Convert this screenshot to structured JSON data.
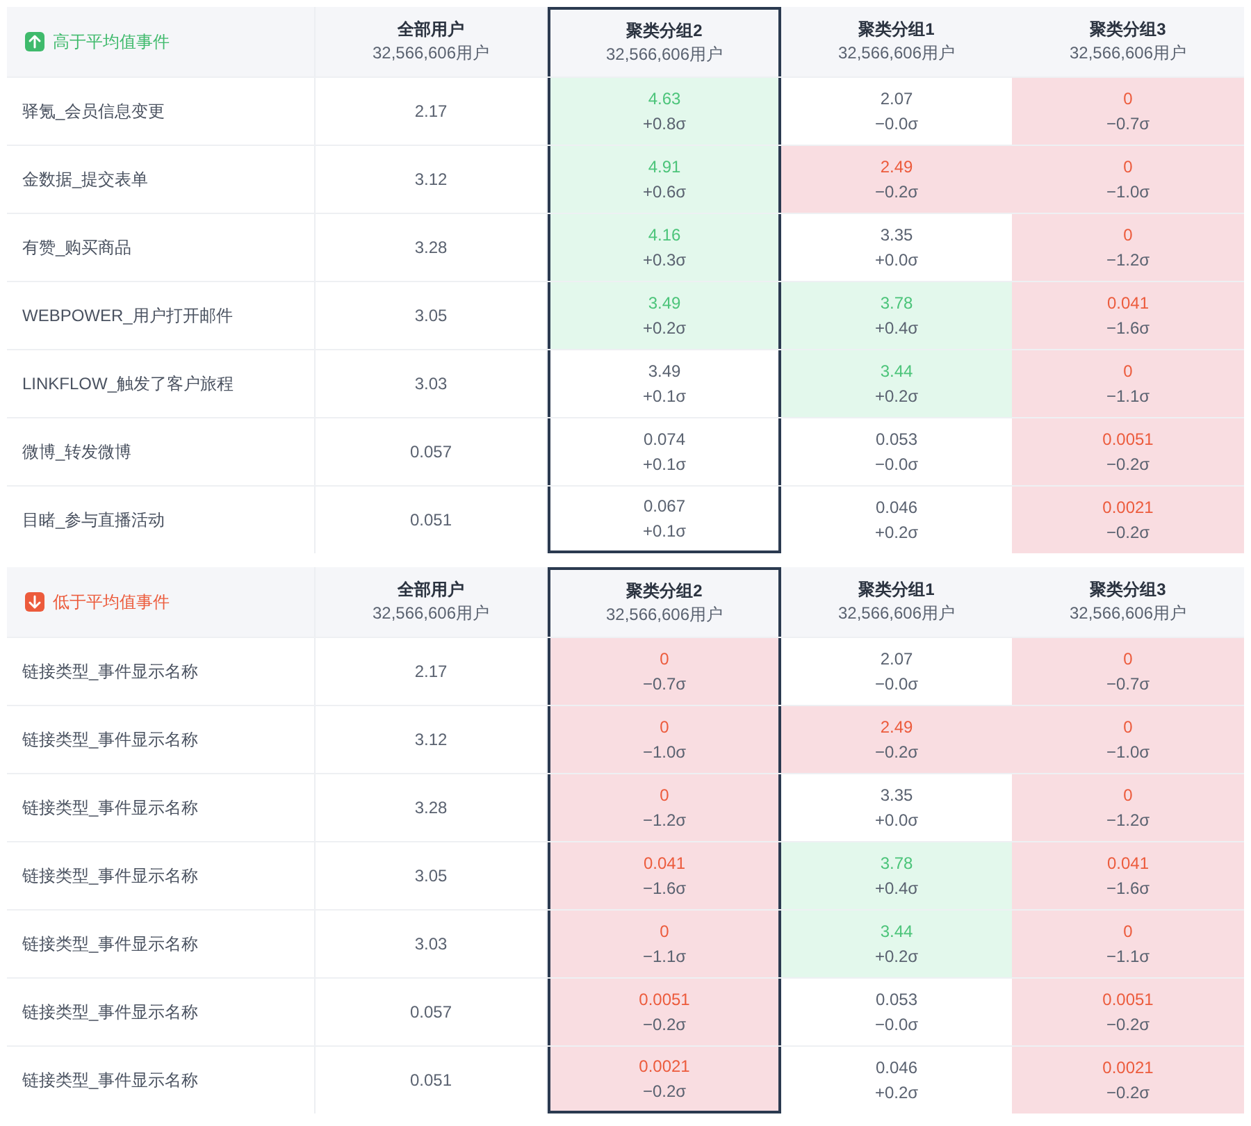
{
  "sections": [
    {
      "kind": "above",
      "title": "高于平均值事件",
      "columns": [
        {
          "title": "全部用户",
          "count": "32,566,606用户",
          "selected": false
        },
        {
          "title": "聚类分组2",
          "count": "32,566,606用户",
          "selected": true
        },
        {
          "title": "聚类分组1",
          "count": "32,566,606用户",
          "selected": false
        },
        {
          "title": "聚类分组3",
          "count": "32,566,606用户",
          "selected": false
        }
      ],
      "rows": [
        {
          "event": "驿氪_会员信息变更",
          "cells": [
            {
              "value": "2.17",
              "high": false,
              "low": false
            },
            {
              "value": "4.63",
              "sigma": "+0.8σ",
              "high": true,
              "low": false
            },
            {
              "value": "2.07",
              "sigma": "−0.0σ",
              "high": false,
              "low": false
            },
            {
              "value": "0",
              "sigma": "−0.7σ",
              "high": false,
              "low": true
            }
          ]
        },
        {
          "event": "金数据_提交表单",
          "cells": [
            {
              "value": "3.12",
              "high": false,
              "low": false
            },
            {
              "value": "4.91",
              "sigma": "+0.6σ",
              "high": true,
              "low": false
            },
            {
              "value": "2.49",
              "sigma": "−0.2σ",
              "high": false,
              "low": true
            },
            {
              "value": "0",
              "sigma": "−1.0σ",
              "high": false,
              "low": true
            }
          ]
        },
        {
          "event": "有赞_购买商品",
          "cells": [
            {
              "value": "3.28",
              "high": false,
              "low": false
            },
            {
              "value": "4.16",
              "sigma": "+0.3σ",
              "high": true,
              "low": false
            },
            {
              "value": "3.35",
              "sigma": "+0.0σ",
              "high": false,
              "low": false
            },
            {
              "value": "0",
              "sigma": "−1.2σ",
              "high": false,
              "low": true
            }
          ]
        },
        {
          "event": "WEBPOWER_用户打开邮件",
          "cells": [
            {
              "value": "3.05",
              "high": false,
              "low": false
            },
            {
              "value": "3.49",
              "sigma": "+0.2σ",
              "high": true,
              "low": false
            },
            {
              "value": "3.78",
              "sigma": "+0.4σ",
              "high": true,
              "low": false
            },
            {
              "value": "0.041",
              "sigma": "−1.6σ",
              "high": false,
              "low": true
            }
          ]
        },
        {
          "event": "LINKFLOW_触发了客户旅程",
          "cells": [
            {
              "value": "3.03",
              "high": false,
              "low": false
            },
            {
              "value": "3.49",
              "sigma": "+0.1σ",
              "high": false,
              "low": false
            },
            {
              "value": "3.44",
              "sigma": "+0.2σ",
              "high": true,
              "low": false
            },
            {
              "value": "0",
              "sigma": "−1.1σ",
              "high": false,
              "low": true
            }
          ]
        },
        {
          "event": "微博_转发微博",
          "cells": [
            {
              "value": "0.057",
              "high": false,
              "low": false
            },
            {
              "value": "0.074",
              "sigma": "+0.1σ",
              "high": false,
              "low": false
            },
            {
              "value": "0.053",
              "sigma": "−0.0σ",
              "high": false,
              "low": false
            },
            {
              "value": "0.0051",
              "sigma": "−0.2σ",
              "high": false,
              "low": true
            }
          ]
        },
        {
          "event": "目睹_参与直播活动",
          "cells": [
            {
              "value": "0.051",
              "high": false,
              "low": false
            },
            {
              "value": "0.067",
              "sigma": "+0.1σ",
              "high": false,
              "low": false
            },
            {
              "value": "0.046",
              "sigma": "+0.2σ",
              "high": false,
              "low": false
            },
            {
              "value": "0.0021",
              "sigma": "−0.2σ",
              "high": false,
              "low": true
            }
          ]
        }
      ]
    },
    {
      "kind": "below",
      "title": "低于平均值事件",
      "columns": [
        {
          "title": "全部用户",
          "count": "32,566,606用户",
          "selected": false
        },
        {
          "title": "聚类分组2",
          "count": "32,566,606用户",
          "selected": true
        },
        {
          "title": "聚类分组1",
          "count": "32,566,606用户",
          "selected": false
        },
        {
          "title": "聚类分组3",
          "count": "32,566,606用户",
          "selected": false
        }
      ],
      "rows": [
        {
          "event": "链接类型_事件显示名称",
          "cells": [
            {
              "value": "2.17",
              "high": false,
              "low": false
            },
            {
              "value": "0",
              "sigma": "−0.7σ",
              "high": false,
              "low": true
            },
            {
              "value": "2.07",
              "sigma": "−0.0σ",
              "high": false,
              "low": false
            },
            {
              "value": "0",
              "sigma": "−0.7σ",
              "high": false,
              "low": true
            }
          ]
        },
        {
          "event": "链接类型_事件显示名称",
          "cells": [
            {
              "value": "3.12",
              "high": false,
              "low": false
            },
            {
              "value": "0",
              "sigma": "−1.0σ",
              "high": false,
              "low": true
            },
            {
              "value": "2.49",
              "sigma": "−0.2σ",
              "high": false,
              "low": true
            },
            {
              "value": "0",
              "sigma": "−1.0σ",
              "high": false,
              "low": true
            }
          ]
        },
        {
          "event": "链接类型_事件显示名称",
          "cells": [
            {
              "value": "3.28",
              "high": false,
              "low": false
            },
            {
              "value": "0",
              "sigma": "−1.2σ",
              "high": false,
              "low": true
            },
            {
              "value": "3.35",
              "sigma": "+0.0σ",
              "high": false,
              "low": false
            },
            {
              "value": "0",
              "sigma": "−1.2σ",
              "high": false,
              "low": true
            }
          ]
        },
        {
          "event": "链接类型_事件显示名称",
          "cells": [
            {
              "value": "3.05",
              "high": false,
              "low": false
            },
            {
              "value": "0.041",
              "sigma": "−1.6σ",
              "high": false,
              "low": true
            },
            {
              "value": "3.78",
              "sigma": "+0.4σ",
              "high": true,
              "low": false
            },
            {
              "value": "0.041",
              "sigma": "−1.6σ",
              "high": false,
              "low": true
            }
          ]
        },
        {
          "event": "链接类型_事件显示名称",
          "cells": [
            {
              "value": "3.03",
              "high": false,
              "low": false
            },
            {
              "value": "0",
              "sigma": "−1.1σ",
              "high": false,
              "low": true
            },
            {
              "value": "3.44",
              "sigma": "+0.2σ",
              "high": true,
              "low": false
            },
            {
              "value": "0",
              "sigma": "−1.1σ",
              "high": false,
              "low": true
            }
          ]
        },
        {
          "event": "链接类型_事件显示名称",
          "cells": [
            {
              "value": "0.057",
              "high": false,
              "low": false
            },
            {
              "value": "0.0051",
              "sigma": "−0.2σ",
              "high": false,
              "low": true
            },
            {
              "value": "0.053",
              "sigma": "−0.0σ",
              "high": false,
              "low": false
            },
            {
              "value": "0.0051",
              "sigma": "−0.2σ",
              "high": false,
              "low": true
            }
          ]
        },
        {
          "event": "链接类型_事件显示名称",
          "cells": [
            {
              "value": "0.051",
              "high": false,
              "low": false
            },
            {
              "value": "0.0021",
              "sigma": "−0.2σ",
              "high": false,
              "low": true
            },
            {
              "value": "0.046",
              "sigma": "+0.2σ",
              "high": false,
              "low": false
            },
            {
              "value": "0.0021",
              "sigma": "−0.2σ",
              "high": false,
              "low": true
            }
          ]
        }
      ]
    }
  ]
}
